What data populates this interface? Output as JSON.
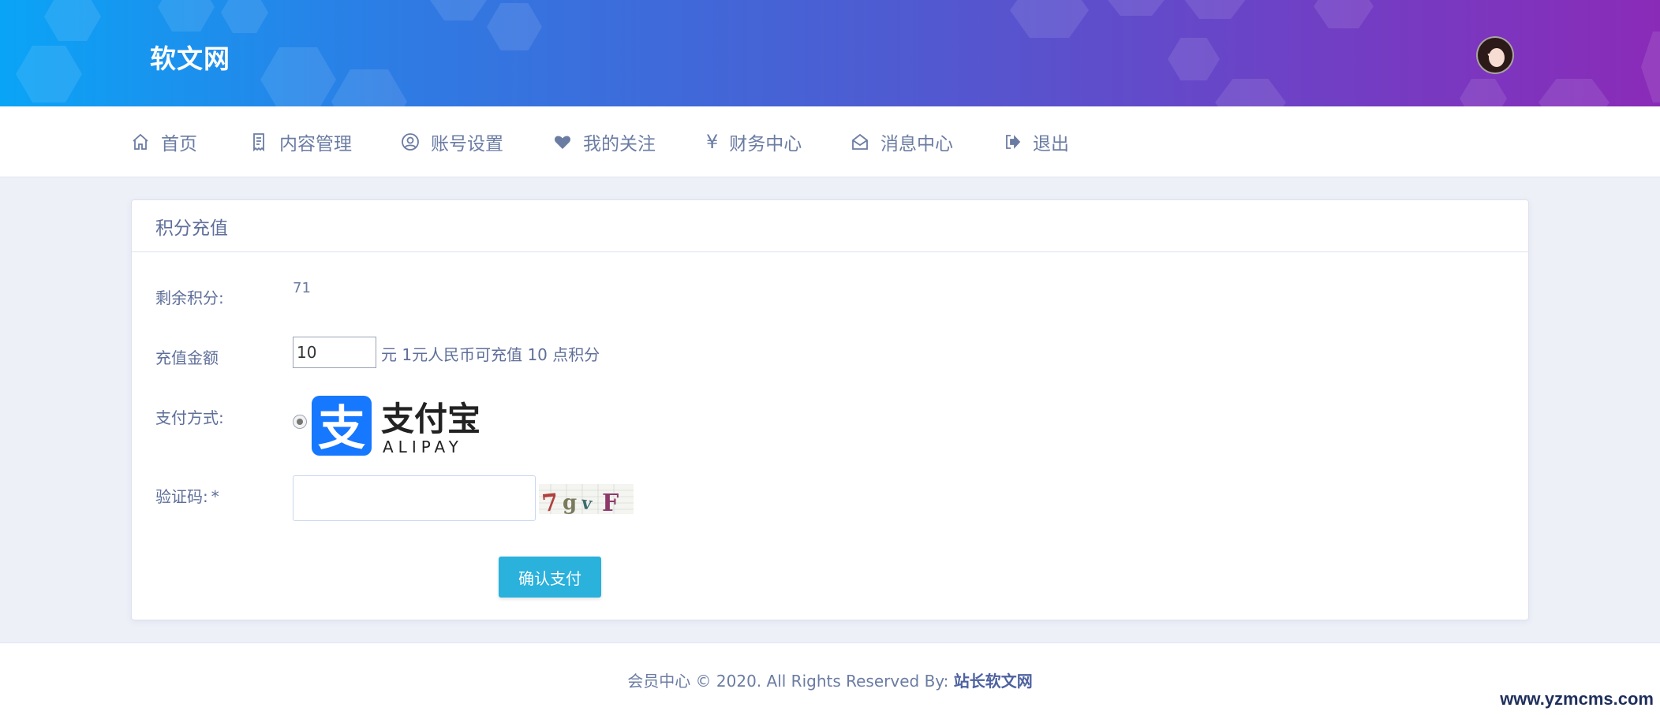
{
  "header": {
    "site_title": "软文网"
  },
  "nav": {
    "items": [
      {
        "label": "首页",
        "icon": "home-icon"
      },
      {
        "label": "内容管理",
        "icon": "document-icon"
      },
      {
        "label": "账号设置",
        "icon": "user-circle-icon"
      },
      {
        "label": "我的关注",
        "icon": "heart-icon"
      },
      {
        "label": "财务中心",
        "icon": "yen-icon",
        "glyph": "¥"
      },
      {
        "label": "消息中心",
        "icon": "envelope-open-icon"
      },
      {
        "label": "退出",
        "icon": "logout-icon"
      }
    ]
  },
  "card": {
    "title": "积分充值",
    "balance_label": "剩余积分:",
    "balance_value": "71",
    "amount_label": "充值金额",
    "amount_value": "10",
    "amount_hint": "元 1元人民币可充值 10 点积分",
    "pay_method_label": "支付方式:",
    "alipay_cn": "支付宝",
    "alipay_en": "ALIPAY",
    "alipay_glyph": "支",
    "captcha_label": "验证码:",
    "captcha_required": "*",
    "captcha_text": "7gvF",
    "submit_label": "确认支付"
  },
  "footer": {
    "prefix": "会员中心 © 2020. All Rights Reserved By:",
    "brand": "站长软文网"
  },
  "watermark": "www.yzmcms.com",
  "colors": {
    "banner_start": "#0aa4f6",
    "banner_end": "#8a2bb8",
    "nav_text": "#6b7ca3",
    "button": "#2ab1dc",
    "alipay_blue": "#1677ff",
    "page_bg": "#eef0f8"
  }
}
